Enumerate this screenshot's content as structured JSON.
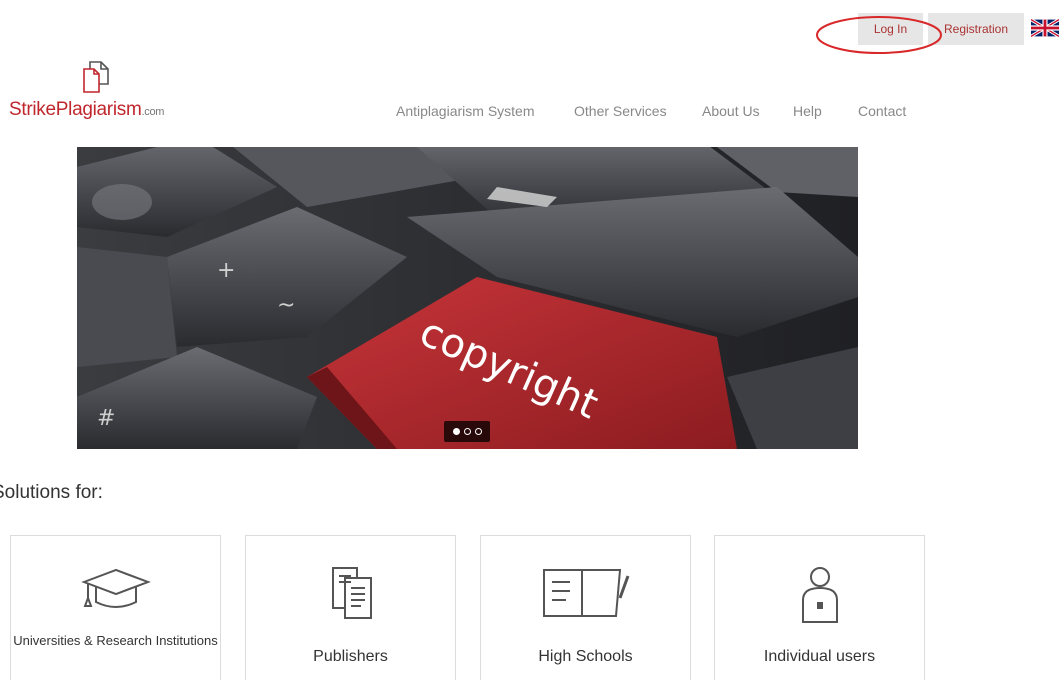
{
  "topbar": {
    "login_label": "Log In",
    "register_label": "Registration",
    "language_icon": "uk-flag-icon"
  },
  "logo": {
    "strike": "Strike",
    "plagiarism": "Plagiarism",
    "com": ".com"
  },
  "nav": {
    "items": [
      {
        "label": "Antiplagiarism System"
      },
      {
        "label": "Other Services"
      },
      {
        "label": "About Us"
      },
      {
        "label": "Help"
      },
      {
        "label": "Contact"
      }
    ]
  },
  "hero": {
    "key_text": "copyright",
    "slide_count": 3,
    "active_slide": 1
  },
  "solutions": {
    "heading": "Solutions for:",
    "cards": [
      {
        "label": "Universities & Research Institutions",
        "icon": "graduation-cap-icon"
      },
      {
        "label": "Publishers",
        "icon": "documents-icon"
      },
      {
        "label": "High Schools",
        "icon": "open-book-icon"
      },
      {
        "label": "Individual users",
        "icon": "user-icon"
      }
    ]
  },
  "colors": {
    "brand_red": "#c0272d",
    "button_gray": "#e6e6e6"
  }
}
